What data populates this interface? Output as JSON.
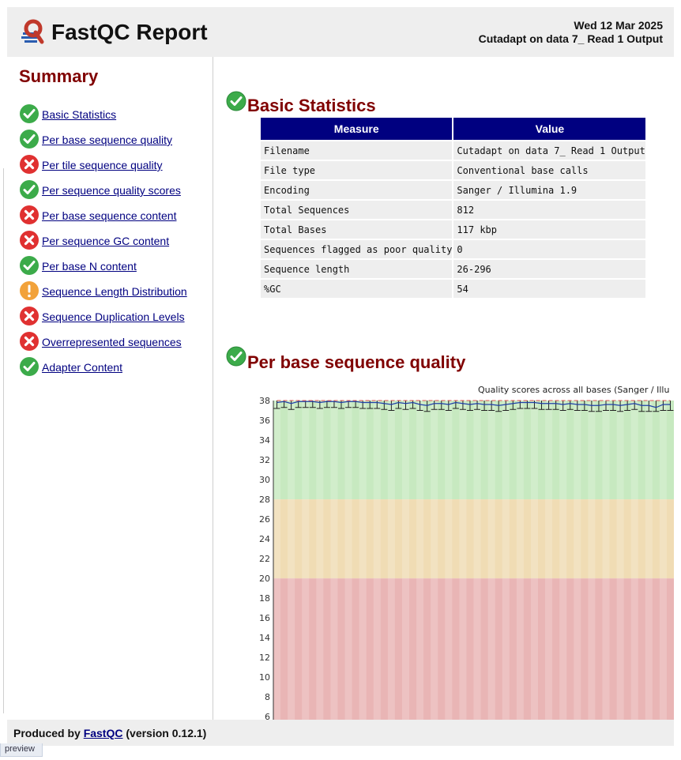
{
  "header": {
    "title": "FastQC Report",
    "date": "Wed 12 Mar 2025",
    "subtitle": "Cutadapt on data 7_ Read 1 Output"
  },
  "summary": {
    "title": "Summary",
    "items": [
      {
        "label": "Basic Statistics",
        "status": "pass"
      },
      {
        "label": "Per base sequence quality",
        "status": "pass"
      },
      {
        "label": "Per tile sequence quality",
        "status": "fail"
      },
      {
        "label": "Per sequence quality scores",
        "status": "pass"
      },
      {
        "label": "Per base sequence content",
        "status": "fail"
      },
      {
        "label": "Per sequence GC content",
        "status": "fail"
      },
      {
        "label": "Per base N content",
        "status": "pass"
      },
      {
        "label": "Sequence Length Distribution",
        "status": "warn"
      },
      {
        "label": "Sequence Duplication Levels",
        "status": "fail"
      },
      {
        "label": "Overrepresented sequences",
        "status": "fail"
      },
      {
        "label": "Adapter Content",
        "status": "pass"
      }
    ]
  },
  "basic_stats": {
    "title": "Basic Statistics",
    "headers": [
      "Measure",
      "Value"
    ],
    "rows": [
      [
        "Filename",
        "Cutadapt on data 7_ Read 1 Output"
      ],
      [
        "File type",
        "Conventional base calls"
      ],
      [
        "Encoding",
        "Sanger / Illumina 1.9"
      ],
      [
        "Total Sequences",
        "812"
      ],
      [
        "Total Bases",
        "117 kbp"
      ],
      [
        "Sequences flagged as poor quality",
        "0"
      ],
      [
        "Sequence length",
        "26-296"
      ],
      [
        "%GC",
        "54"
      ]
    ]
  },
  "quality_section": {
    "title": "Per base sequence quality"
  },
  "chart_data": {
    "type": "line",
    "title": "Quality scores across all bases (Sanger / Illu",
    "y_ticks": [
      "38",
      "36",
      "34",
      "32",
      "30",
      "28",
      "26",
      "24",
      "22",
      "20",
      "18",
      "16",
      "14",
      "12",
      "10",
      "8",
      "6"
    ],
    "ylim": [
      5.7,
      38
    ],
    "zones": [
      {
        "from": 28,
        "to": 38,
        "color": "#c7e9c0"
      },
      {
        "from": 20,
        "to": 28,
        "color": "#f0dcb4"
      },
      {
        "from": 5.7,
        "to": 20,
        "color": "#e9b5b5"
      }
    ],
    "series": [
      {
        "values": [
          37.8,
          37.9,
          37.7,
          37.9,
          37.9,
          37.9,
          37.8,
          37.9,
          37.9,
          37.8,
          37.9,
          37.9,
          37.8,
          37.8,
          37.8,
          37.7,
          37.6,
          37.8,
          37.7,
          37.8,
          37.6,
          37.5,
          37.7,
          37.7,
          37.6,
          37.8,
          37.7,
          37.6,
          37.7,
          37.6,
          37.6,
          37.5,
          37.6,
          37.7,
          37.8,
          37.8,
          37.8,
          37.7,
          37.7,
          37.7,
          37.6,
          37.7,
          37.6,
          37.6,
          37.5,
          37.5,
          37.6,
          37.6,
          37.5,
          37.6,
          37.7,
          37.5,
          37.5,
          37.3,
          37.6,
          37.6
        ]
      },
      {
        "values": [
          38,
          38,
          38,
          38,
          38,
          38,
          38,
          38,
          38,
          38,
          38,
          38,
          38,
          38,
          38,
          38,
          38,
          38,
          38,
          38,
          38,
          38,
          38,
          38,
          38,
          38,
          38,
          38,
          38,
          38,
          38,
          38,
          38,
          38,
          38,
          38,
          38,
          38,
          38,
          38,
          38,
          38,
          38,
          38,
          38,
          38,
          38,
          38,
          38,
          38,
          38,
          38,
          38,
          38,
          38,
          38
        ],
        "color": "#e05050"
      }
    ]
  },
  "footer": {
    "prefix": "Produced by",
    "link": "FastQC",
    "suffix": "(version 0.12.1)"
  },
  "preview_tab": "preview",
  "colors": {
    "heading": "#800000",
    "table_header": "#000080",
    "pass": "#3cab4a",
    "fail": "#e03131",
    "warn": "#f2a23a"
  }
}
